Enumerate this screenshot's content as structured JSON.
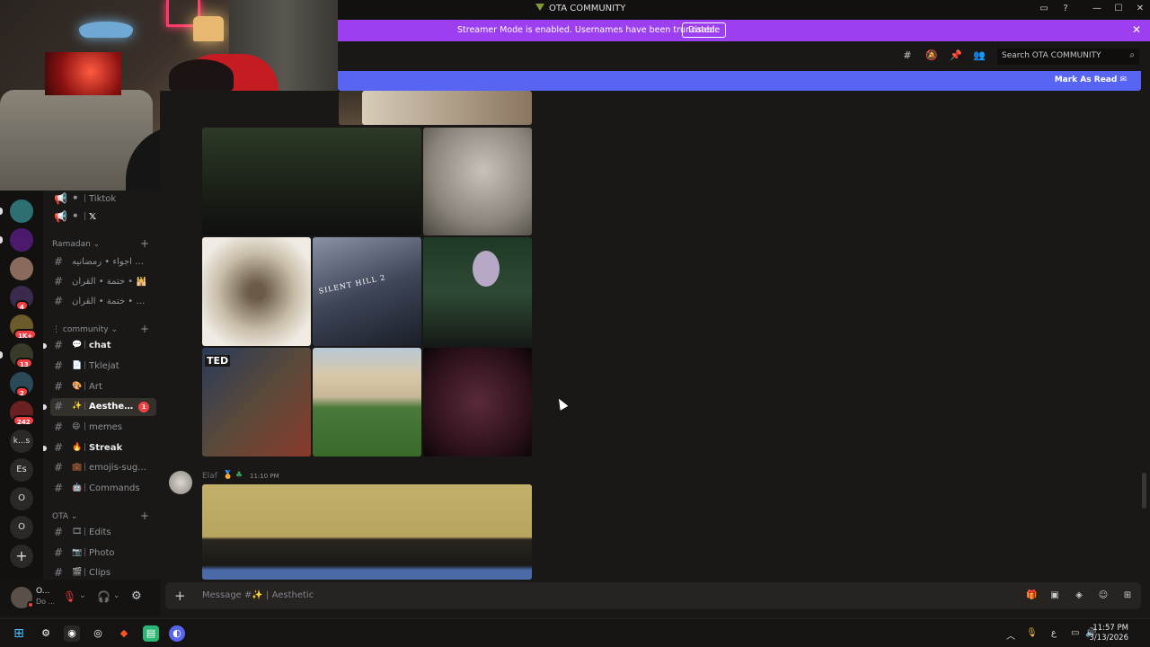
{
  "window": {
    "title": "OTA COMMUNITY",
    "controls": [
      "—",
      "☐",
      "✕"
    ]
  },
  "banner": {
    "text": "Streamer Mode is enabled. Usernames have been truncated.",
    "disable_label": "Disable"
  },
  "toolbar": {
    "search_placeholder": "Search OTA COMMUNITY",
    "mark_as_read": "Mark As Read"
  },
  "servers": [
    {
      "label": "",
      "badge": ""
    },
    {
      "label": "",
      "badge": ""
    },
    {
      "label": "",
      "badge": ""
    },
    {
      "label": "",
      "badge": "4"
    },
    {
      "label": "",
      "badge": "1K+"
    },
    {
      "label": "",
      "badge": "13"
    },
    {
      "label": "",
      "badge": "2"
    },
    {
      "label": "",
      "badge": "242"
    },
    {
      "label": "k...s",
      "badge": ""
    },
    {
      "label": "Es",
      "badge": ""
    },
    {
      "label": "O",
      "badge": ""
    },
    {
      "label": "O",
      "badge": ""
    }
  ],
  "channels": {
    "top": [
      {
        "emoji": "📢",
        "name": "Tiktok"
      },
      {
        "emoji": "📢",
        "name": "𝕏"
      }
    ],
    "categories": {
      "ramadan": "Ramadan",
      "community": "community",
      "ota": "OTA"
    },
    "ramadan": [
      {
        "name": "اجواء • رمضانيه • ..."
      },
      {
        "name": "ختمة • القرآن • 🕌"
      },
      {
        "name": "فريق • ختمة • القرآن..."
      }
    ],
    "community": [
      {
        "emoji": "💬",
        "name": "chat"
      },
      {
        "emoji": "📄",
        "name": "Tklejat"
      },
      {
        "emoji": "🎨",
        "name": "Art"
      },
      {
        "emoji": "✨",
        "name": "Aesthe...",
        "badge": "1"
      },
      {
        "emoji": "😄",
        "name": "memes"
      },
      {
        "emoji": "🔥",
        "name": "Streak"
      },
      {
        "emoji": "💼",
        "name": "emojis-sug..."
      },
      {
        "emoji": "🤖",
        "name": "Commands"
      }
    ],
    "ota": [
      {
        "emoji": "🎞",
        "name": "Edits"
      },
      {
        "emoji": "📷",
        "name": "Photo"
      },
      {
        "emoji": "🎬",
        "name": "Clips"
      }
    ]
  },
  "user": {
    "name": "O...",
    "status": "Do ..."
  },
  "message": {
    "author": "Elaf",
    "time": "11:10 PM"
  },
  "images": {
    "silent_hill_text": "SILENT HILL 2",
    "poster_text": "TED"
  },
  "composer": {
    "placeholder": "Message #✨ | Aesthetic"
  },
  "taskbar": {
    "time": "11:57 PM",
    "date": "3/13/2026",
    "lang": "ع"
  },
  "colors": {
    "accent": "#5865f2",
    "banner": "#9b3ff0",
    "badge": "#f23f43"
  }
}
